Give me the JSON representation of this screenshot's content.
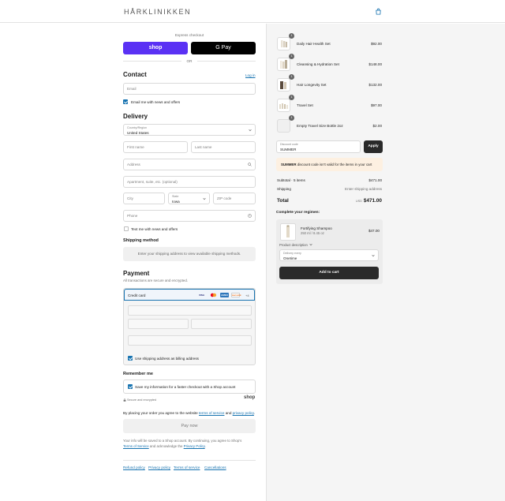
{
  "header": {
    "brand": "HÅRKLINIKKEN",
    "cart_icon": "bag-icon"
  },
  "express": {
    "label": "Express checkout",
    "shop_label": "shop",
    "gpay_label": "G Pay",
    "or_label": "OR"
  },
  "contact": {
    "title": "Contact",
    "login_link": "Log in",
    "email_placeholder": "Email",
    "news_label": "Email me with news and offers",
    "news_checked": true
  },
  "delivery": {
    "title": "Delivery",
    "country_label": "Country/Region",
    "country_value": "United States",
    "first_name_placeholder": "First name",
    "last_name_placeholder": "Last name",
    "address_placeholder": "Address",
    "apartment_placeholder": "Apartment, suite, etc. (optional)",
    "city_placeholder": "City",
    "state_label": "State",
    "state_value": "Iowa",
    "zip_placeholder": "ZIP code",
    "phone_placeholder": "Phone",
    "text_news_label": "Text me with news and offers",
    "text_news_checked": false
  },
  "shipping_method": {
    "title": "Shipping method",
    "note": "Enter your shipping address to view available shipping methods."
  },
  "payment": {
    "title": "Payment",
    "subtitle": "All transactions are secure and encrypted.",
    "method_label": "Credit card",
    "card_brands": [
      "VISA",
      "MC",
      "AMEX",
      "DISCOVER",
      "+4"
    ],
    "billing_label": "Use shipping address as billing address",
    "billing_checked": true
  },
  "remember": {
    "title": "Remember me",
    "save_label": "Save my information for a faster checkout with a Shop account",
    "save_checked": true,
    "secure_label": "Secure and encrypted",
    "shop_logo": "shop"
  },
  "legal": {
    "prefix": "By placing your order you agree to the website ",
    "terms": "terms of service",
    "and": " and ",
    "privacy": "privacy policy",
    "suffix": ".",
    "shop_note_1": "Your info will be saved to a Shop account. By continuing, you agree to Shop's",
    "shop_terms": "Terms of Service",
    "shop_and": " and acknowledge the ",
    "shop_privacy": "Privacy Policy",
    "shop_suffix": "."
  },
  "pay_button": "Pay now",
  "footer_links": [
    "Refund policy",
    "Privacy policy",
    "Terms of service",
    "Cancellations"
  ],
  "cart": {
    "items": [
      {
        "qty": "1",
        "name": "Daily Hair Health Set",
        "price": "$92.00"
      },
      {
        "qty": "1",
        "name": "Cleansing & Hydration Set",
        "price": "$148.00"
      },
      {
        "qty": "1",
        "name": "Hair Longevity Set",
        "price": "$132.00"
      },
      {
        "qty": "1",
        "name": "Travel Set",
        "price": "$97.00"
      },
      {
        "qty": "1",
        "name": "Empty Travel Size Bottle 2oz",
        "price": "$2.00"
      }
    ],
    "discount_label": "Discount code",
    "discount_value": "SUMMER",
    "apply_label": "Apply",
    "discount_error_code": "SUMMER",
    "discount_error_text": " discount code isn't valid for the items in your cart",
    "subtotal_label": "Subtotal · 5 items",
    "subtotal_value": "$471.00",
    "shipping_label": "Shipping",
    "shipping_value": "Enter shipping address",
    "total_label": "Total",
    "total_currency": "USD",
    "total_value": "$471.00"
  },
  "regimen": {
    "title": "Complete your regimen:",
    "product_name": "Fortifying Shampoo",
    "product_size": "250 ml / 8.45 oz",
    "product_price": "$47.00",
    "description_label": "Product description",
    "delivery_label": "Delivery every",
    "delivery_value": "Onetime",
    "add_label": "Add to cart"
  }
}
